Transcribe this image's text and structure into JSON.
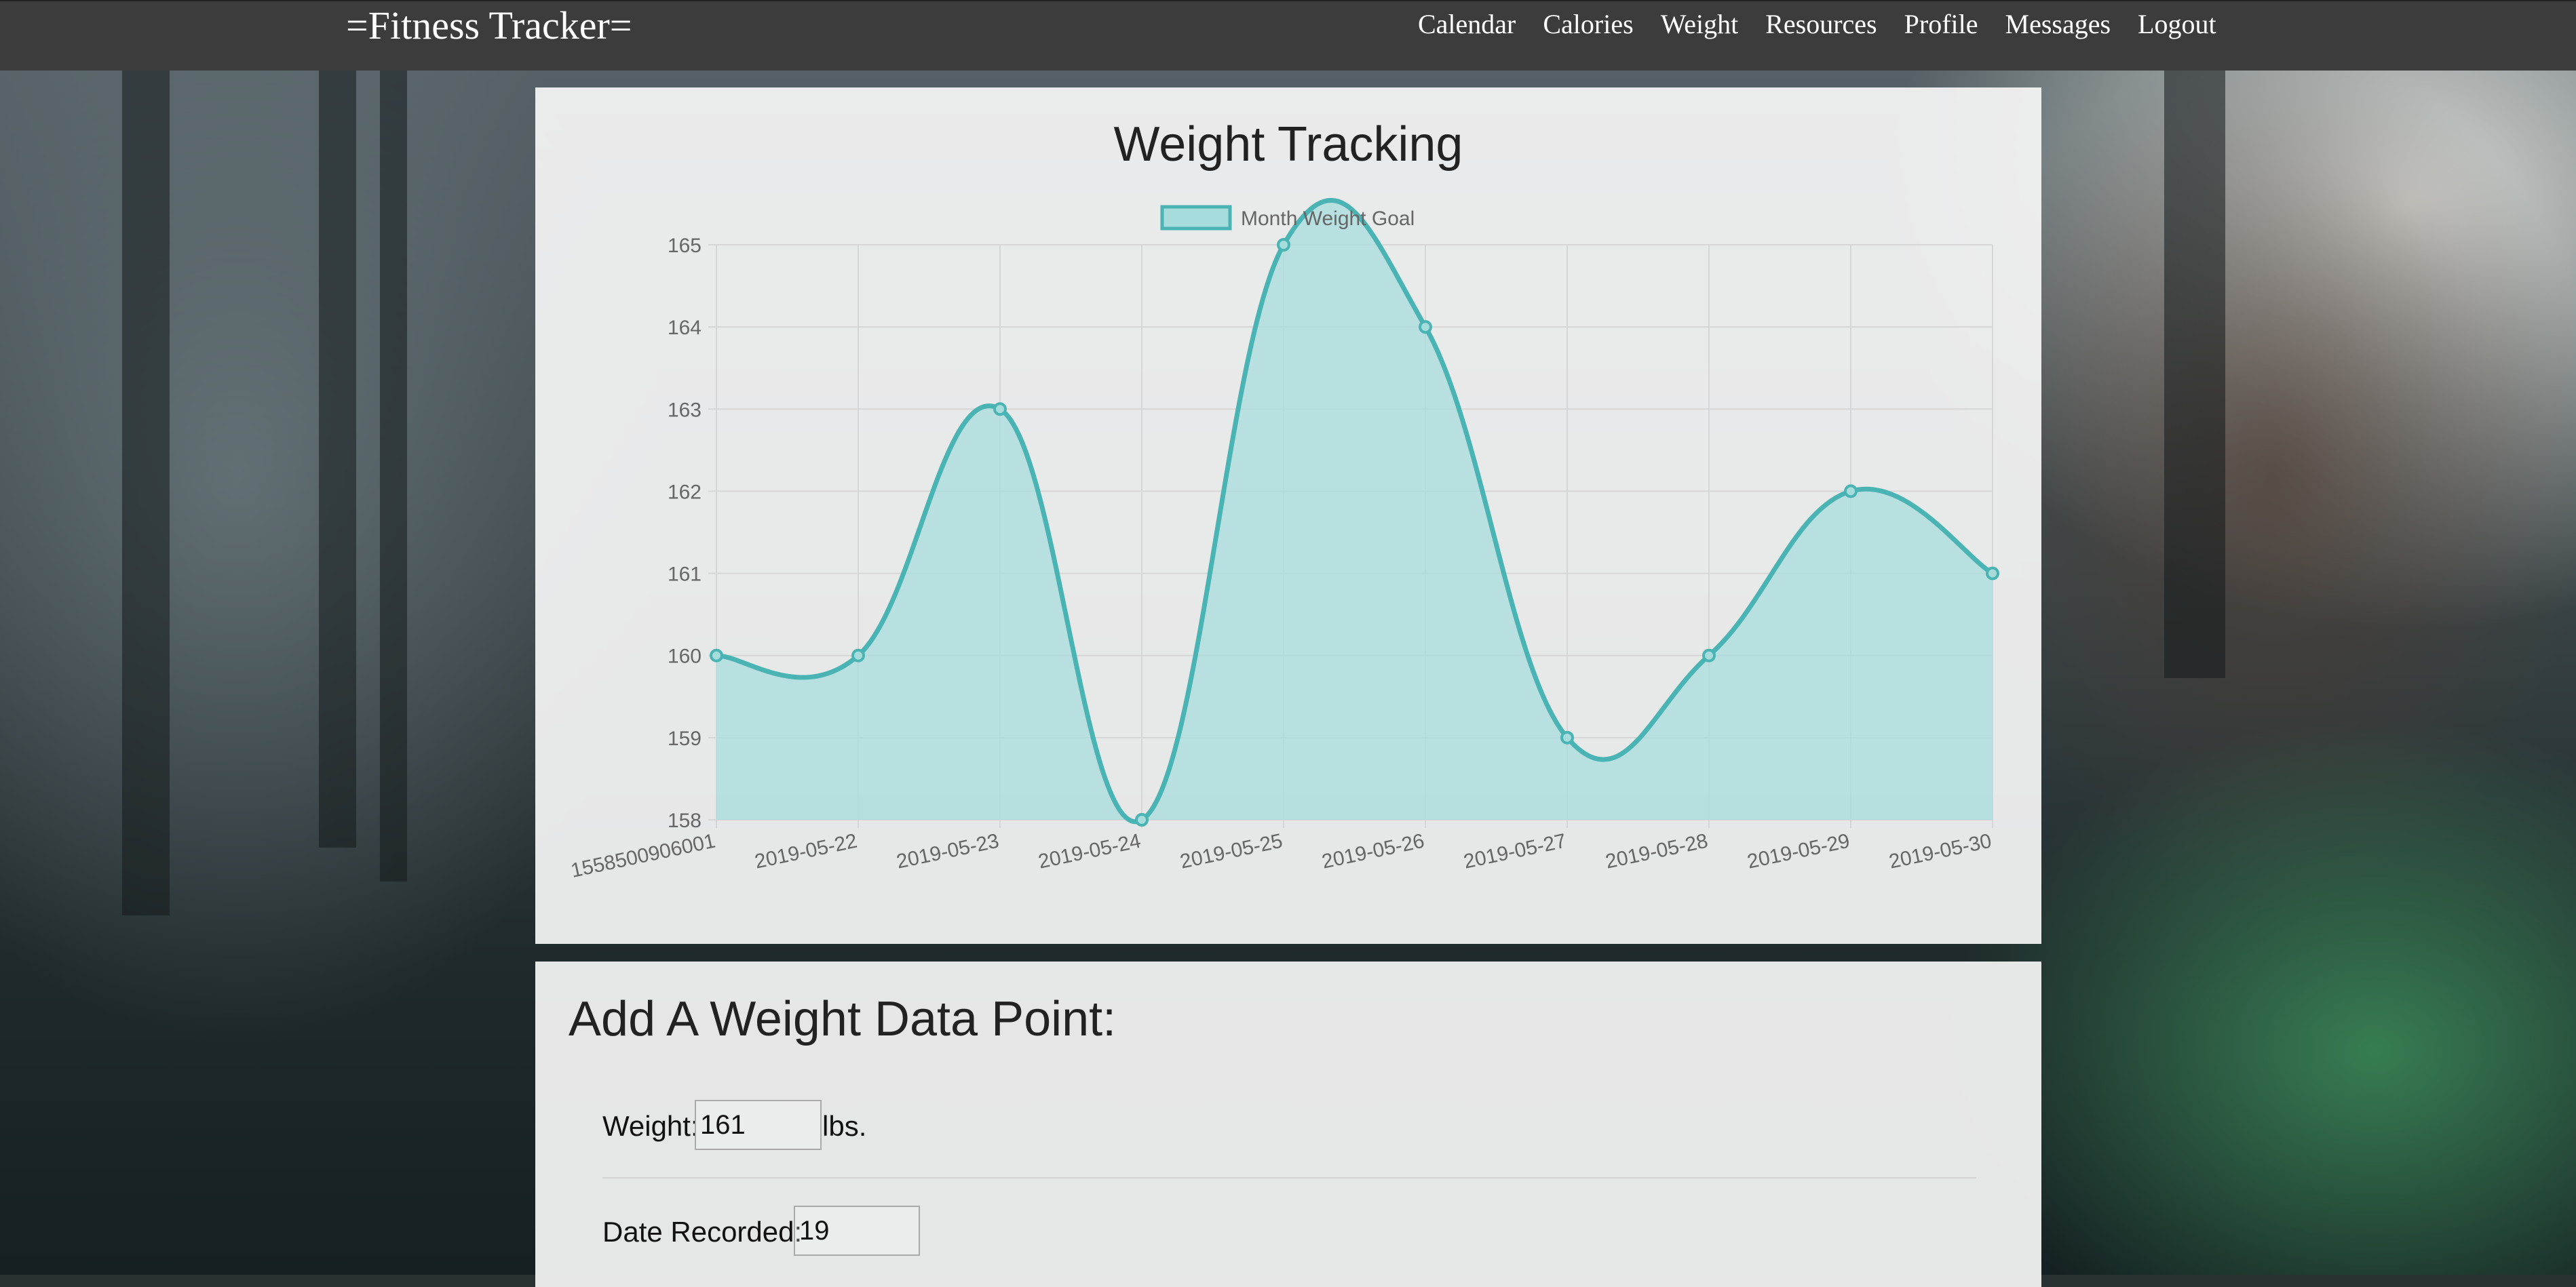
{
  "navbar": {
    "brand": "=Fitness Tracker=",
    "links": [
      "Calendar",
      "Calories",
      "Weight",
      "Resources",
      "Profile",
      "Messages",
      "Logout"
    ]
  },
  "chart_card": {
    "title": "Weight Tracking"
  },
  "chart_data": {
    "type": "area",
    "title": "Weight Tracking",
    "categories": [
      "1558500906001",
      "2019-05-22",
      "2019-05-23",
      "2019-05-24",
      "2019-05-25",
      "2019-05-26",
      "2019-05-27",
      "2019-05-28",
      "2019-05-29",
      "2019-05-30"
    ],
    "series": [
      {
        "name": "Month Weight Goal",
        "values": [
          160,
          160,
          163,
          158,
          165,
          164,
          159,
          160,
          162,
          161
        ]
      }
    ],
    "yticks": [
      "158",
      "159",
      "160",
      "161",
      "162",
      "163",
      "164",
      "165"
    ],
    "ylim": [
      158,
      165
    ],
    "grid": true,
    "legend": "top",
    "colors": {
      "line": "#4ab3b3",
      "fill": "#a6dcdc"
    }
  },
  "form": {
    "heading": "Add A Weight Data Point:",
    "weight_label": "Weight:",
    "weight_value": "161",
    "weight_unit": "lbs.",
    "date_label": "Date Recorded:",
    "date_value": "19"
  }
}
